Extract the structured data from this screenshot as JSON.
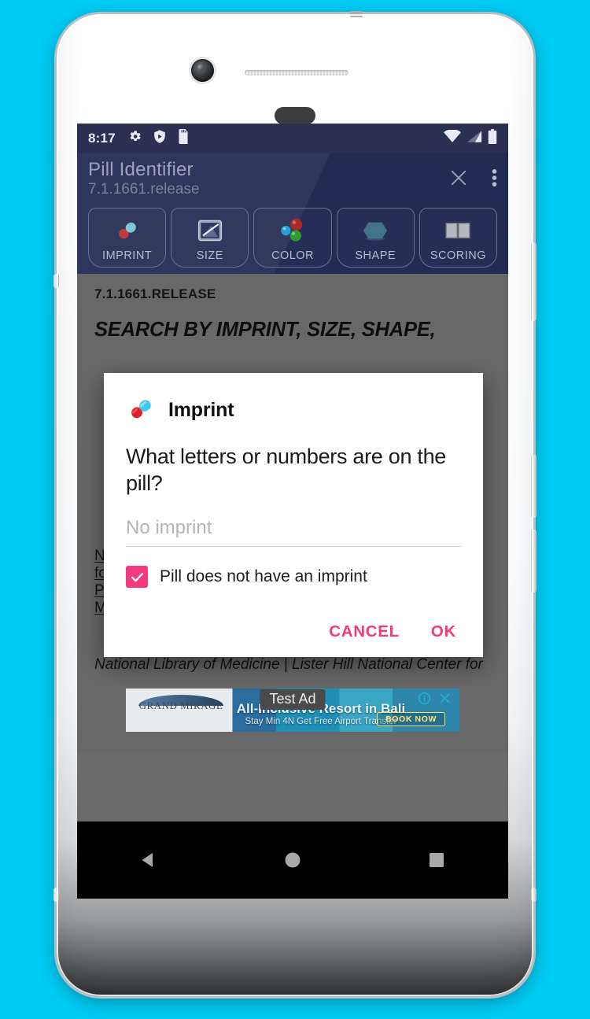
{
  "status_bar": {
    "time": "8:17",
    "left_icons": [
      "settings-gear-icon",
      "play-protect-icon",
      "sd-card-icon"
    ],
    "right_icons": [
      "wifi-icon",
      "cellular-signal-icon",
      "battery-icon"
    ]
  },
  "app_bar": {
    "title": "Pill Identifier",
    "version": "7.1.1661.release",
    "close_label": "×",
    "overflow_label": "⋮",
    "background_color": "#232a54"
  },
  "tabs": [
    {
      "label": "IMPRINT",
      "icon": "pill-icon"
    },
    {
      "label": "SIZE",
      "icon": "ruler-image-icon"
    },
    {
      "label": "COLOR",
      "icon": "color-spheres-icon"
    },
    {
      "label": "SHAPE",
      "icon": "hexagon-icon"
    },
    {
      "label": "SCORING",
      "icon": "scored-tablet-icon"
    }
  ],
  "content": {
    "release_label": "7.1.1661.RELEASE",
    "heading": "SEARCH BY IMPRINT, SIZE, SHAPE,",
    "credits_link": "National Library of Medicine | Lister Hill National Center for Biomedical Communications | Office of High Performance Computing and Communications | Medicos Consultants LLC",
    "credits_plain": "National Library of Medicine | Lister Hill National Center for"
  },
  "ad": {
    "test_label": "Test Ad",
    "brand": "GRAND MIRAGE",
    "headline": "All-Inclusive Resort in Bali",
    "subline": "Stay Min 4N Get Free Airport Transfer",
    "cta": "BOOK NOW",
    "info_icon": "ad-info-icon",
    "close_icon": "ad-close-icon"
  },
  "dialog": {
    "icon": "pill-icon",
    "title": "Imprint",
    "message": "What letters or numbers are on the pill?",
    "input_value": "",
    "input_placeholder": "No imprint",
    "checkbox_label": "Pill does not have an imprint",
    "checkbox_checked": true,
    "accent_color": "#f5397e",
    "cancel_label": "CANCEL",
    "ok_label": "OK"
  },
  "nav_bar": {
    "back_label": "back-button",
    "home_label": "home-button",
    "recents_label": "recents-button"
  },
  "device": {
    "background_color": "#00ccf5"
  }
}
